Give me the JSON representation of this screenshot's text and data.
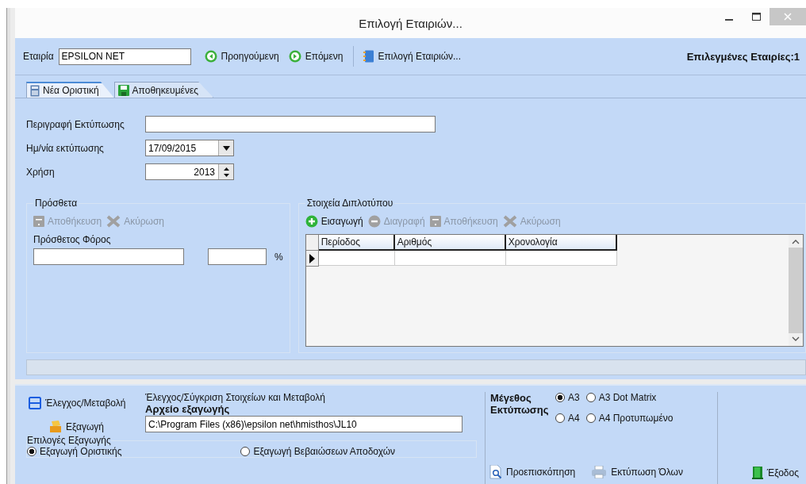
{
  "window": {
    "title": "Επιλογή Εταιριών..."
  },
  "toolbar": {
    "company_label": "Εταιρία",
    "company_value": "EPSILON NET",
    "buttons": [
      {
        "label": "Προηγούμενη",
        "kind": "prev"
      },
      {
        "label": "Επόμενη",
        "kind": "next"
      },
      {
        "label": "Επιλογή Εταιριών...",
        "kind": "book"
      }
    ],
    "selected_count": "Επιλεγμένες Εταιρίες:1"
  },
  "tabs": [
    {
      "label": "Νέα Οριστική",
      "selected": true,
      "kind": "calc"
    },
    {
      "label": "Αποθηκευμένες",
      "selected": false,
      "kind": "save"
    }
  ],
  "fields": [
    {
      "label": "Περιγραφή Εκτύπωσης",
      "kind": "text"
    },
    {
      "label": "Ημ/νία εκτύπωσης",
      "value": "17/09/2015",
      "kind": "date"
    },
    {
      "label": "Χρήση",
      "value": "2013",
      "kind": "spin"
    }
  ],
  "extras": {
    "title": "Πρόσθετα",
    "actions": [
      {
        "label": "Αποθήκευση",
        "kind": "save",
        "disabled": true
      },
      {
        "label": "Ακύρωση",
        "kind": "cancel",
        "disabled": true
      }
    ],
    "tax_label": "Πρόσθετος Φόρος",
    "percent": "%"
  },
  "duplicate": {
    "title": "Στοιχεία Διπλοτύπου",
    "actions": [
      {
        "label": "Εισαγωγή",
        "kind": "add",
        "disabled": false
      },
      {
        "label": "Διαγραφή",
        "kind": "delete",
        "disabled": true
      },
      {
        "label": "Αποθήκευση",
        "kind": "save",
        "disabled": true
      },
      {
        "label": "Ακύρωση",
        "kind": "cancel",
        "disabled": true
      }
    ],
    "table": {
      "columns": [
        "Περίοδος",
        "Αριθμός",
        "Χρονολογία"
      ]
    }
  },
  "bottom": {
    "check_button": "Έλεγχος/Μεταβολή",
    "description": "Έλεγχος/Σύγκριση Στοιχείων και Μεταβολή",
    "export_file_label": "Αρχείο εξαγωγής",
    "export_path": "C:\\Program Files (x86)\\epsilon net\\hmisthos\\JL10",
    "export_button": "Εξαγωγή",
    "export_options_title": "Επιλογές Εξαγωγής",
    "export_options": [
      {
        "label": "Εξαγωγή Οριστικής",
        "selected": true
      },
      {
        "label": "Εξαγωγή Βεβαιώσεων Αποδοχών",
        "selected": false
      }
    ],
    "print_size_label": "Μέγεθος Εκτύπωσης",
    "print_sizes": [
      {
        "label": "A3",
        "selected": true
      },
      {
        "label": "A3 Dot Matrix",
        "selected": false
      },
      {
        "label": "A4",
        "selected": false
      },
      {
        "label": "A4 Προτυπωμένο",
        "selected": false
      }
    ],
    "preview_button": "Προεπισκόπηση",
    "print_all_button": "Εκτύπωση Όλων",
    "exit_button": "Έξοδος"
  }
}
